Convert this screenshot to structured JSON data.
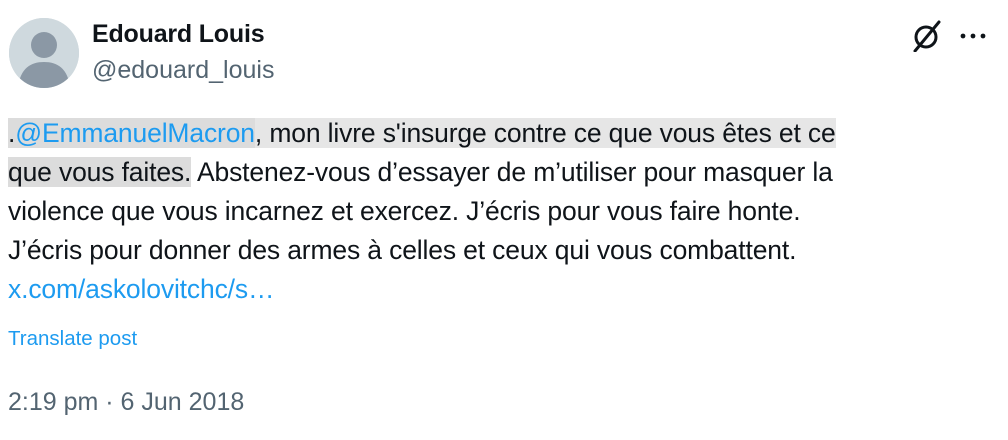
{
  "author": {
    "display_name": "Edouard Louis",
    "handle": "@edouard_louis",
    "avatar_icon": "default-avatar-icon"
  },
  "header_icons": {
    "logo_icon": "x-grok-logo-icon",
    "more_icon": "more-horizontal-icon"
  },
  "post": {
    "lines": [
      {
        "prefix": ".",
        "mention": "@EmmanuelMacron",
        "rest": ", mon livre s'insurge contre ce que vous êtes et ce"
      },
      {
        "highlighted": "que vous faites.",
        "rest": " Abstenez-vous d’essayer de m’utiliser pour masquer la"
      },
      {
        "text": "violence que vous incarnez et exercez. J’écris pour vous faire honte."
      },
      {
        "text": "J’écris pour donner des armes à celles et ceux qui vous combattent."
      },
      {
        "link": "x.com/askolovitchc/s…"
      }
    ]
  },
  "translate_label": "Translate post",
  "timestamp": "2:19 pm · 6 Jun 2018",
  "colors": {
    "link": "#1d9bf0",
    "text": "#0f1419",
    "secondary": "#536471",
    "highlight": "#dcdcdc",
    "avatar_bg": "#cfd9de"
  }
}
